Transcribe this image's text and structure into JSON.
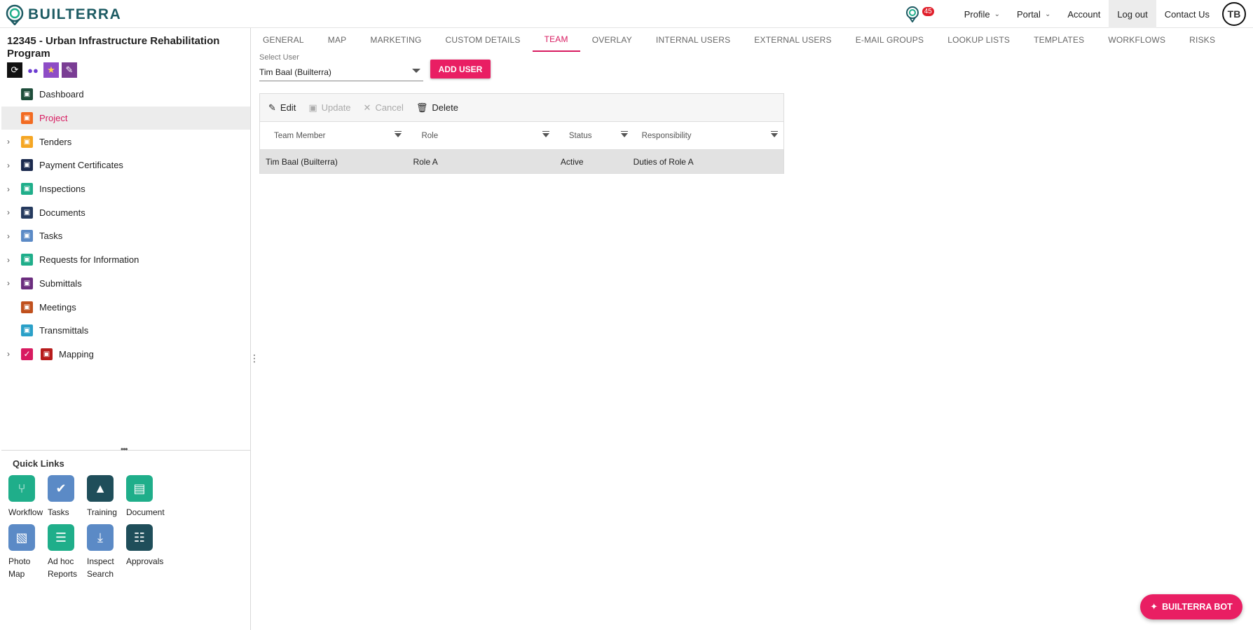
{
  "header": {
    "brand": "BUILTERRA",
    "notification_count": "45",
    "menu": {
      "profile": "Profile",
      "portal": "Portal",
      "account": "Account",
      "logout": "Log out",
      "contact": "Contact Us"
    },
    "avatar_initials": "TB"
  },
  "sidebar": {
    "project_title": "12345 - Urban Infrastructure Rehabilitation Program",
    "items": [
      {
        "label": "Dashboard",
        "expandable": false,
        "icon": "dashboard-icon",
        "color": "#1e4d3a"
      },
      {
        "label": "Project",
        "expandable": false,
        "icon": "project-icon",
        "color": "#f26b21"
      },
      {
        "label": "Tenders",
        "expandable": true,
        "icon": "tenders-icon",
        "color": "#f5a623"
      },
      {
        "label": "Payment Certificates",
        "expandable": true,
        "icon": "payment-icon",
        "color": "#1b2a4e"
      },
      {
        "label": "Inspections",
        "expandable": true,
        "icon": "inspections-icon",
        "color": "#1fae8a"
      },
      {
        "label": "Documents",
        "expandable": true,
        "icon": "documents-icon",
        "color": "#253a5e"
      },
      {
        "label": "Tasks",
        "expandable": true,
        "icon": "tasks-icon",
        "color": "#5b8ac6"
      },
      {
        "label": "Requests for Information",
        "expandable": true,
        "icon": "rfi-icon",
        "color": "#1fae8a"
      },
      {
        "label": "Submittals",
        "expandable": true,
        "icon": "submittals-icon",
        "color": "#6b2d7e"
      },
      {
        "label": "Meetings",
        "expandable": false,
        "icon": "meetings-icon",
        "color": "#c0501d"
      },
      {
        "label": "Transmittals",
        "expandable": false,
        "icon": "transmittals-icon",
        "color": "#2aa0c8"
      },
      {
        "label": "Mapping",
        "expandable": true,
        "icon": "mapping-icon",
        "color": "#b71c1c"
      }
    ],
    "quick_links": {
      "title": "Quick Links",
      "items": [
        {
          "label": "Workflow",
          "icon": "workflow-icon",
          "color": "#1fae8a"
        },
        {
          "label": "Tasks",
          "icon": "tasks-icon",
          "color": "#5b8ac6"
        },
        {
          "label": "Training",
          "icon": "graduation-cap-icon",
          "color": "#1f4e5a"
        },
        {
          "label": "Document",
          "icon": "archive-icon",
          "color": "#1fae8a"
        },
        {
          "label": "Photo Map",
          "icon": "image-icon",
          "color": "#5b8ac6"
        },
        {
          "label": "Ad hoc Reports",
          "icon": "report-icon",
          "color": "#1fae8a"
        },
        {
          "label": "Inspect Search",
          "icon": "download-icon",
          "color": "#5b8ac6"
        },
        {
          "label": "Approvals",
          "icon": "document-icon",
          "color": "#1f4e5a"
        }
      ]
    }
  },
  "tabs": [
    {
      "label": "GENERAL",
      "active": false
    },
    {
      "label": "MAP",
      "active": false
    },
    {
      "label": "MARKETING",
      "active": false
    },
    {
      "label": "CUSTOM DETAILS",
      "active": false
    },
    {
      "label": "TEAM",
      "active": true
    },
    {
      "label": "OVERLAY",
      "active": false
    },
    {
      "label": "INTERNAL USERS",
      "active": false
    },
    {
      "label": "EXTERNAL USERS",
      "active": false
    },
    {
      "label": "E-MAIL GROUPS",
      "active": false
    },
    {
      "label": "LOOKUP LISTS",
      "active": false
    },
    {
      "label": "TEMPLATES",
      "active": false
    },
    {
      "label": "WORKFLOWS",
      "active": false
    },
    {
      "label": "RISKS",
      "active": false
    }
  ],
  "team": {
    "select_label": "Select User",
    "select_value": "Tim Baal (Builterra)",
    "add_button": "ADD USER",
    "toolbar": {
      "edit": "Edit",
      "update": "Update",
      "cancel": "Cancel",
      "delete": "Delete"
    },
    "columns": [
      "Team Member",
      "Role",
      "Status",
      "Responsibility"
    ],
    "rows": [
      [
        "Tim Baal (Builterra)",
        "Role A",
        "Active",
        "Duties of Role A"
      ]
    ]
  },
  "bot_button": "BUILTERRA BOT",
  "accent_color": "#e91e63"
}
